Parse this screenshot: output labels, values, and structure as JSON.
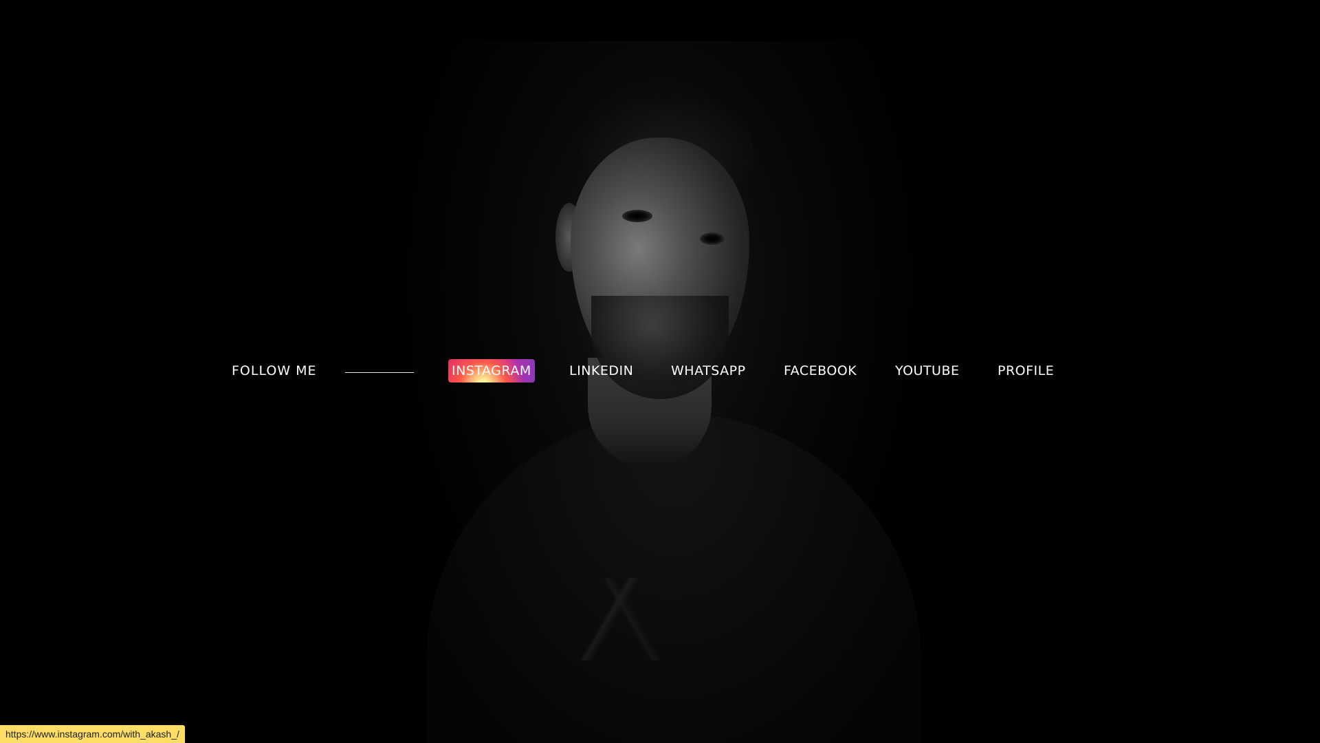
{
  "nav": {
    "follow_label": "FOLLOW ME",
    "links": [
      {
        "label": "INSTAGRAM",
        "active": true
      },
      {
        "label": "LINKEDIN",
        "active": false
      },
      {
        "label": "WHATSAPP",
        "active": false
      },
      {
        "label": "FACEBOOK",
        "active": false
      },
      {
        "label": "YOUTUBE",
        "active": false
      },
      {
        "label": "PROFILE",
        "active": false
      }
    ]
  },
  "statusbar": {
    "url": "https://www.instagram.com/with_akash_/"
  },
  "colors": {
    "background": "#000000",
    "text": "#ffffff",
    "statusbar_bg": "#fcdd65",
    "instagram_gradient": [
      "#fdf497",
      "#fd5949",
      "#d6249f",
      "#8a3ab9"
    ]
  }
}
